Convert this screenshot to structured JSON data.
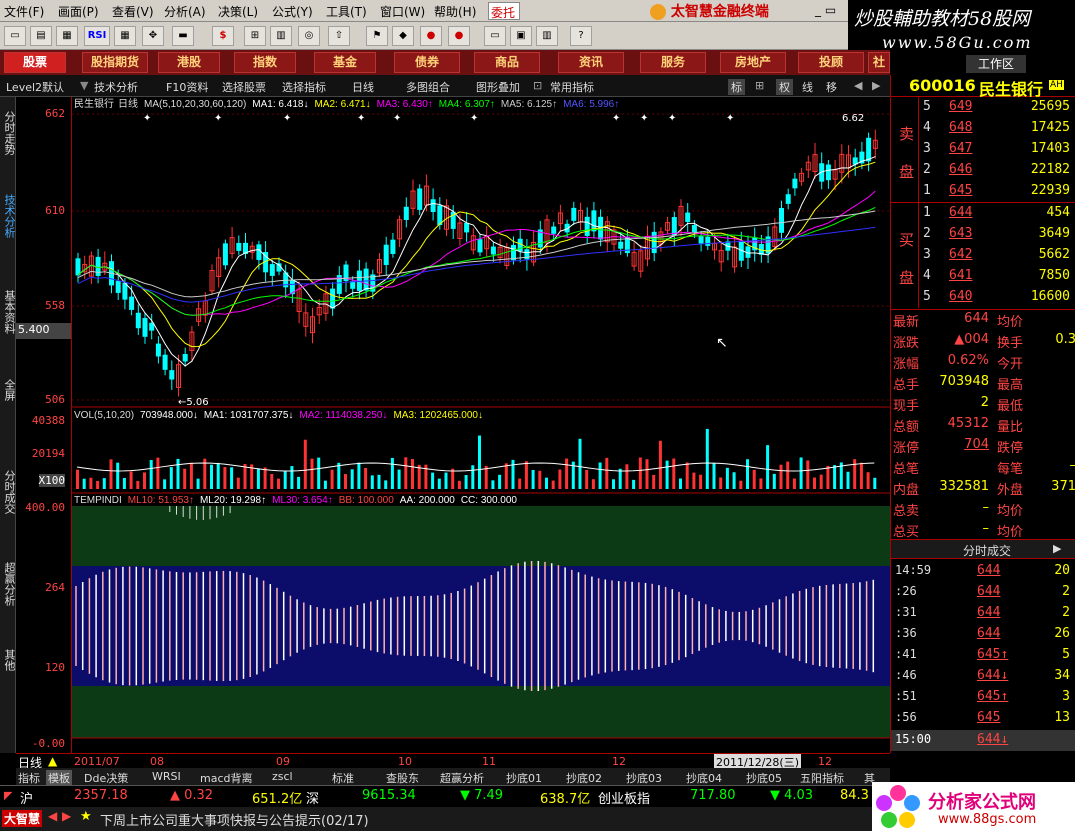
{
  "menu": {
    "items": [
      "文件(F)",
      "画面(P)",
      "查看(V)",
      "分析(A)",
      "决策(L)",
      "公式(Y)",
      "工具(T)",
      "窗口(W)",
      "帮助(H)"
    ],
    "weituo": "委托",
    "brand": "太智慧金融终端"
  },
  "watermark_top": {
    "line1": "炒股輔助教材58股网",
    "line2": "www.58Gu.com"
  },
  "toolbar": {
    "rsi_label": "RSI"
  },
  "nav": {
    "items": [
      "股票",
      "股指期货",
      "港股",
      "指数",
      "基金",
      "债券",
      "商品",
      "资讯",
      "服务",
      "房地产",
      "投顾",
      "社区"
    ],
    "active": "股票",
    "extra": "工作区"
  },
  "subbar": {
    "items": [
      "Level2默认",
      "技术分析",
      "F10资料",
      "选择股票",
      "选择指标",
      "日线",
      "多图组合",
      "图形叠加",
      "常用指标"
    ],
    "right_buttons": [
      "标",
      "权",
      "线",
      "移"
    ]
  },
  "left_rail": [
    "分时走势",
    "技术分析",
    "基本资料",
    "全屏",
    "分时成交",
    "超赢分析",
    "其他"
  ],
  "price_axis": {
    "ticks": [
      "662",
      "610",
      "558",
      "506"
    ],
    "current": "5.400"
  },
  "vol_axis": {
    "ticks": [
      "40388",
      "20194",
      "X100"
    ]
  },
  "ind_axis": {
    "ticks": [
      "400.00",
      "264",
      "120",
      "-0.00"
    ]
  },
  "main_legend": {
    "stock": "民生银行",
    "period": "日线",
    "ma_params": "MA(5,10,20,30,60,120)",
    "ma1": "MA1: 6.418↓",
    "ma2": "MA2: 6.471↓",
    "ma3": "MA3: 6.430↑",
    "ma4": "MA4: 6.307↑",
    "ma5": "MA5: 6.125↑",
    "ma6": "MA6: 5.996↑",
    "high_label": "6.62",
    "low_label": "5.06"
  },
  "vol_legend": {
    "params": "VOL(5,10,20)",
    "vol": "703948.000↓",
    "ma1": "MA1: 1031707.375↓",
    "ma2": "MA2: 1114038.250↓",
    "ma3": "MA3: 1202465.000↓"
  },
  "ind_legend": {
    "name": "TEMPINDI",
    "ml10": "ML10: 51.953↑",
    "ml20": "ML20: 19.298↑",
    "ml30": "ML30: 3.654↑",
    "bb": "BB: 100.000",
    "aa": "AA: 200.000",
    "cc": "CC: 300.000"
  },
  "x_axis": {
    "labels": [
      "2011/07",
      "08",
      "09",
      "10",
      "11",
      "12"
    ],
    "cursor_date": "2011/12/28(三)",
    "after_cursor": "12"
  },
  "period_label": "日线",
  "bottom_tabs": [
    "指标",
    "模板",
    "Dde决策",
    "WRSI",
    "macd背离",
    "zscl",
    "标准",
    "查股东",
    "超赢分析",
    "抄底01",
    "抄底02",
    "抄底03",
    "抄底04",
    "抄底05",
    "五阳指标",
    "其"
  ],
  "quote": {
    "code": "600016",
    "name": "民生银行",
    "badge": "AH",
    "sell_label": [
      "卖",
      "盘"
    ],
    "buy_label": [
      "买",
      "盘"
    ],
    "sell": [
      {
        "idx": "5",
        "price": "649",
        "vol": "25695"
      },
      {
        "idx": "4",
        "price": "648",
        "vol": "17425"
      },
      {
        "idx": "3",
        "price": "647",
        "vol": "17403"
      },
      {
        "idx": "2",
        "price": "646",
        "vol": "22182"
      },
      {
        "idx": "1",
        "price": "645",
        "vol": "22939"
      }
    ],
    "buy": [
      {
        "idx": "1",
        "price": "644",
        "vol": "454"
      },
      {
        "idx": "2",
        "price": "643",
        "vol": "3649"
      },
      {
        "idx": "3",
        "price": "642",
        "vol": "5662"
      },
      {
        "idx": "4",
        "price": "641",
        "vol": "7850"
      },
      {
        "idx": "5",
        "price": "640",
        "vol": "16600"
      }
    ],
    "stats": [
      {
        "l1": "最新",
        "v1": "644",
        "l2": "均价",
        "v2": ""
      },
      {
        "l1": "涨跌",
        "v1": "▲004",
        "l2": "换手",
        "v2": "0.3"
      },
      {
        "l1": "涨幅",
        "v1": "0.62%",
        "l2": "今开",
        "v2": ""
      },
      {
        "l1": "总手",
        "v1": "703948",
        "l2": "最高",
        "v2": ""
      },
      {
        "l1": "现手",
        "v1": "2",
        "l2": "最低",
        "v2": ""
      },
      {
        "l1": "总额",
        "v1": "45312",
        "l2": "量比",
        "v2": ""
      },
      {
        "l1": "涨停",
        "v1": "704",
        "l2": "跌停",
        "v2": ""
      },
      {
        "l1": "总笔",
        "v1": "",
        "l2": "每笔",
        "v2": "–"
      },
      {
        "l1": "内盘",
        "v1": "332581",
        "l2": "外盘",
        "v2": "371"
      },
      {
        "l1": "总卖",
        "v1": "–",
        "l2": "均价",
        "v2": ""
      },
      {
        "l1": "总买",
        "v1": "–",
        "l2": "均价",
        "v2": ""
      }
    ],
    "ticks_header": "分时成交",
    "ticks": [
      {
        "t": "14:59",
        "p": "644",
        "v": "20"
      },
      {
        "t": ":26",
        "p": "644",
        "v": "2"
      },
      {
        "t": ":31",
        "p": "644",
        "v": "2"
      },
      {
        "t": ":36",
        "p": "644",
        "v": "26"
      },
      {
        "t": ":41",
        "p": "645↑",
        "v": "5"
      },
      {
        "t": ":46",
        "p": "644↓",
        "v": "34"
      },
      {
        "t": ":51",
        "p": "645↑",
        "v": "3"
      },
      {
        "t": ":56",
        "p": "645",
        "v": "13"
      }
    ],
    "tick_close": {
      "t": "15:00",
      "p": "644↓"
    }
  },
  "status": {
    "sh_label": "沪",
    "sh_index": "2357.18",
    "sh_change": "▲ 0.32",
    "sh_amount": "651.2亿",
    "sz_label": "深",
    "sz_index": "9615.34",
    "sz_change": "▼ 7.49",
    "sz_amount": "638.7亿",
    "cyb_label": "创业板指",
    "cyb_index": "717.80",
    "cyb_change": "▼ 4.03",
    "cyb_amount": "84.3"
  },
  "news": {
    "logo": "大智慧",
    "text": "下周上市公司重大事项快报与公告提示(02/17)"
  },
  "watermark_bottom": {
    "line1": "分析家公式网",
    "line2": "www.88gs.com"
  },
  "colors": {
    "up": "#ff3333",
    "down": "#00ffff",
    "ma1": "#ffffff",
    "ma2": "#ffff00",
    "ma3": "#ff00ff",
    "ma4": "#00ff00",
    "ma5": "#cccccc",
    "ma6": "#3030ff",
    "band_green": "#0b3a14",
    "band_blue": "#0c0c6a"
  }
}
